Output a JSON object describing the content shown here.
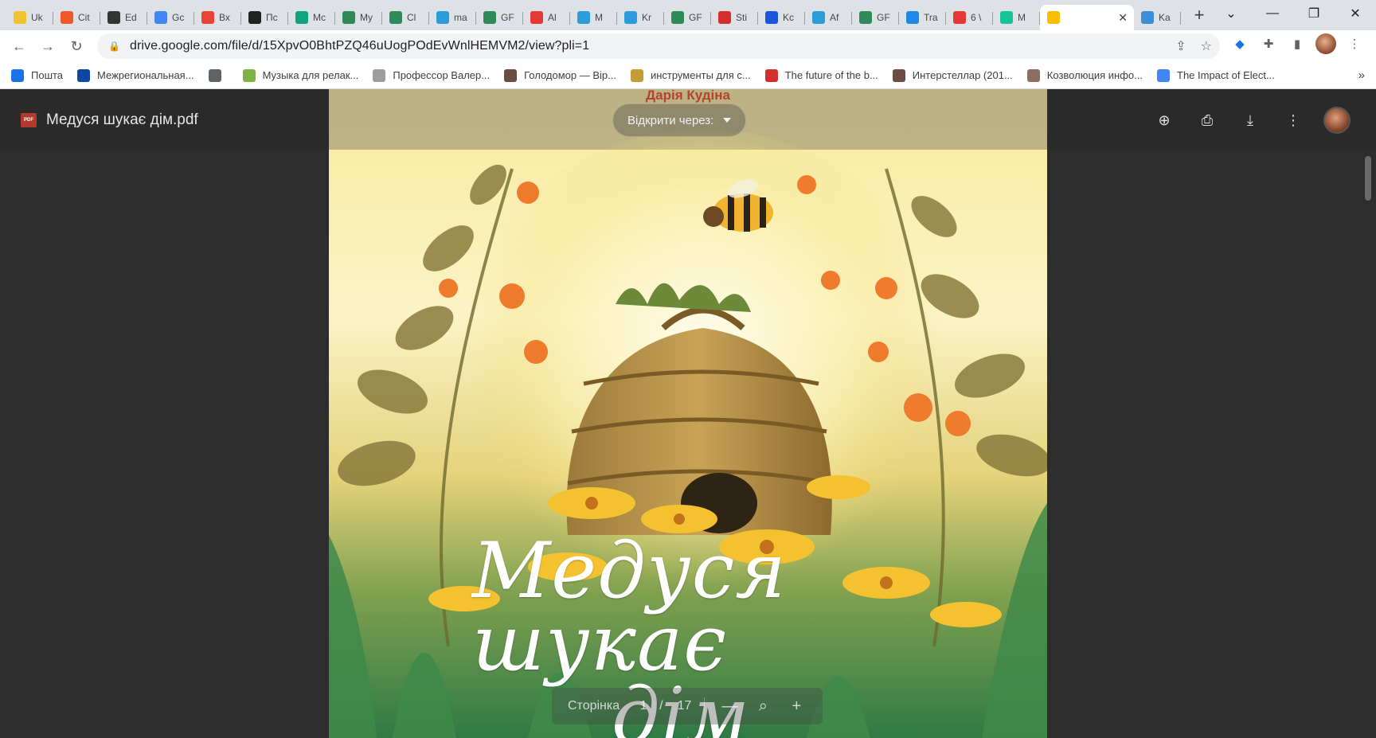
{
  "browser": {
    "tabs": [
      {
        "label": "Uk",
        "icon": "sun-icon",
        "color": "#f2c230"
      },
      {
        "label": "Cit",
        "icon": "orange-sun-icon",
        "color": "#f0572a"
      },
      {
        "label": "Ed",
        "icon": "shield-logo-icon",
        "color": "#333333"
      },
      {
        "label": "Gc",
        "icon": "translate-icon",
        "color": "#4285f4"
      },
      {
        "label": "Вх",
        "icon": "gmail-icon",
        "color": "#ea4335"
      },
      {
        "label": "Пс",
        "icon": "trident-icon",
        "color": "#222222"
      },
      {
        "label": "Mc",
        "icon": "chatgpt-icon",
        "color": "#10a37f"
      },
      {
        "label": "My",
        "icon": "gf-icon",
        "color": "#2e8b57"
      },
      {
        "label": "Cl",
        "icon": "gf-icon",
        "color": "#2e8b57"
      },
      {
        "label": "ma",
        "icon": "grid-icon",
        "color": "#2d9cdb"
      },
      {
        "label": "GF",
        "icon": "gf-icon",
        "color": "#2e8b57"
      },
      {
        "label": "Al",
        "icon": "bar-chart-icon",
        "color": "#e53935"
      },
      {
        "label": "M",
        "icon": "grid-icon",
        "color": "#2d9cdb"
      },
      {
        "label": "Kr",
        "icon": "grid-icon",
        "color": "#2d9cdb"
      },
      {
        "label": "GF",
        "icon": "gf-icon",
        "color": "#2e8b57"
      },
      {
        "label": "Sti",
        "icon": "flag-icon",
        "color": "#d32f2f"
      },
      {
        "label": "Kc",
        "icon": "dots-icon",
        "color": "#1a56db"
      },
      {
        "label": "Af",
        "icon": "grid-icon",
        "color": "#2d9cdb"
      },
      {
        "label": "GF",
        "icon": "gf-icon",
        "color": "#2e8b57"
      },
      {
        "label": "Tra",
        "icon": "circle-c-icon",
        "color": "#1e88e5"
      },
      {
        "label": "6 \\",
        "icon": "sparkle-icon",
        "color": "#e53935"
      },
      {
        "label": "M",
        "icon": "grammarly-icon",
        "color": "#15c39a"
      },
      {
        "label": "",
        "icon": "google-drive-icon",
        "color": "#fbbc04",
        "active": true
      },
      {
        "label": "Ka",
        "icon": "snowflake-icon",
        "color": "#3a8fd6"
      }
    ],
    "new_tab_label": "+",
    "url": "drive.google.com/file/d/15XpvO0BhtPZQ46uUogPOdEvWnlHEMVM2/view?pli=1",
    "bookmarks": [
      {
        "label": "Пошта",
        "icon": "mail-icon",
        "color": "#1a73e8"
      },
      {
        "label": "Межрегиональная...",
        "icon": "region-logo-icon",
        "color": "#0d47a1"
      },
      {
        "label": "",
        "icon": "globe-icon",
        "color": "#5f6368"
      },
      {
        "label": "Музыка для релак...",
        "icon": "music-icon",
        "color": "#7cb342"
      },
      {
        "label": "Профессор Валер...",
        "icon": "page-icon",
        "color": "#9e9e9e"
      },
      {
        "label": "Голодомор — Вір...",
        "icon": "bird-icon",
        "color": "#6d4c41"
      },
      {
        "label": "инструменты для с...",
        "icon": "tools-icon",
        "color": "#c69c3b"
      },
      {
        "label": "The future of the b...",
        "icon": "letter-e-icon",
        "color": "#d32f2f"
      },
      {
        "label": "Интерстеллар (201...",
        "icon": "film-icon",
        "color": "#6d4c41"
      },
      {
        "label": "Козволюция инфо...",
        "icon": "image-icon",
        "color": "#8d6e63"
      },
      {
        "label": "The Impact of Elect...",
        "icon": "google-g-icon",
        "color": "#4285f4"
      }
    ]
  },
  "viewer": {
    "file_title": "Медуся шукає дім.pdf",
    "pdf_badge": "PDF",
    "open_with_label": "Відкрити через:",
    "author": "Дарія Кудіна",
    "cover_title_line1": "Медуся шукає",
    "cover_title_line2": "дім",
    "pager": {
      "label": "Сторінка",
      "current": "1",
      "separator": "/",
      "total": "17",
      "zoom_out": "—",
      "zoom_in": "+"
    }
  }
}
